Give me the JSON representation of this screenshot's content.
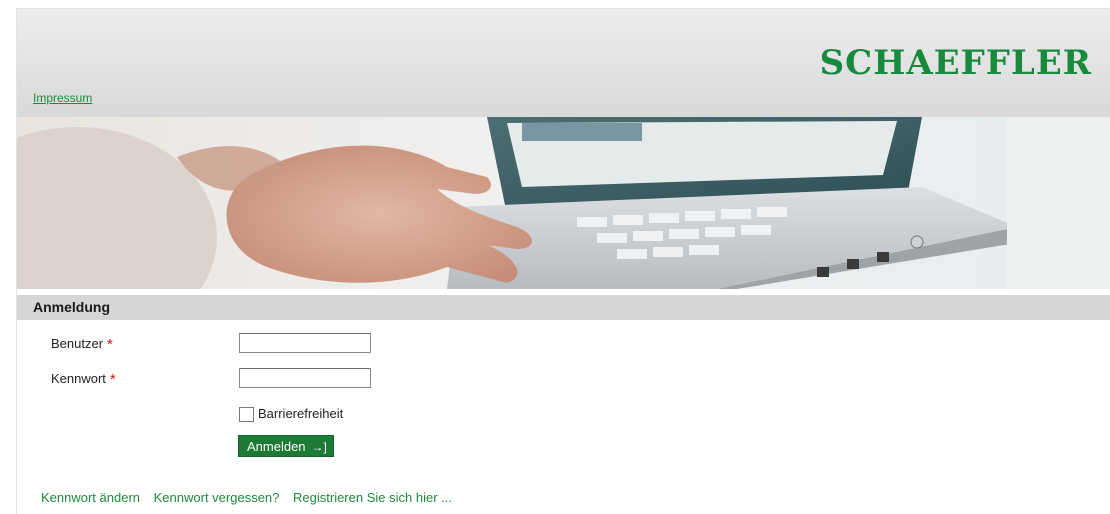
{
  "header": {
    "logo_text": "SCHAEFFLER",
    "impressum_link": "Impressum"
  },
  "banner": {
    "image": "hands-typing-on-laptop-photo"
  },
  "section": {
    "title": "Anmeldung"
  },
  "form": {
    "user_label": "Benutzer",
    "user_value": "",
    "password_label": "Kennwort",
    "password_value": "",
    "required_marker": "*",
    "accessibility_label": "Barrierefreiheit",
    "accessibility_checked": false,
    "login_button_label": "Anmelden",
    "login_button_icon": "login-arrow-icon"
  },
  "footer": {
    "links": [
      "Kennwort ändern",
      "Kennwort vergessen?",
      "Registrieren Sie sich hier ..."
    ]
  },
  "colors": {
    "brand_green": "#178a3c",
    "button_green": "#1c7a34",
    "required_red": "#d01818"
  }
}
